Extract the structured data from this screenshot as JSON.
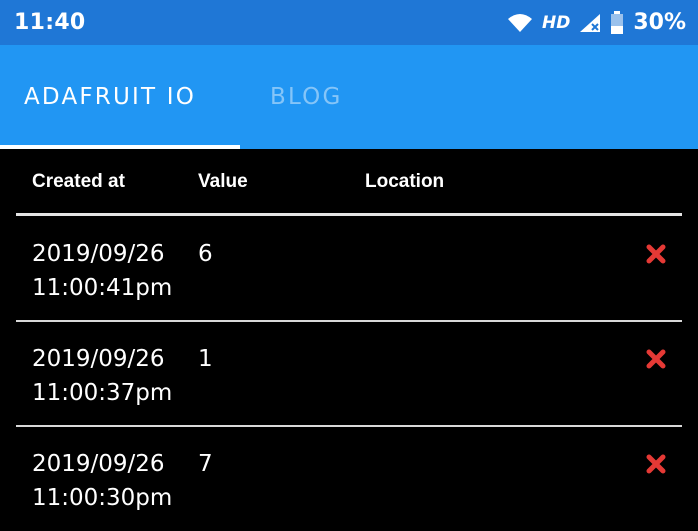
{
  "status_bar": {
    "time": "11:40",
    "network": "HD",
    "battery": "30%",
    "icons": [
      "wifi-icon",
      "signal-icon",
      "battery-icon"
    ]
  },
  "tabs": [
    {
      "label": "ADAFRUIT IO",
      "active": true
    },
    {
      "label": "BLOG",
      "active": false
    }
  ],
  "table": {
    "headers": {
      "created_at": "Created at",
      "value": "Value",
      "location": "Location"
    },
    "rows": [
      {
        "date": "2019/09/26",
        "time": "11:00:41pm",
        "value": "6",
        "location": ""
      },
      {
        "date": "2019/09/26",
        "time": "11:00:37pm",
        "value": "1",
        "location": ""
      },
      {
        "date": "2019/09/26",
        "time": "11:00:30pm",
        "value": "7",
        "location": ""
      }
    ],
    "delete_icon": "close-icon"
  },
  "colors": {
    "status_bar": "#1f77d6",
    "app_bar": "#2196f3",
    "background": "#000000",
    "delete": "#e53935"
  }
}
